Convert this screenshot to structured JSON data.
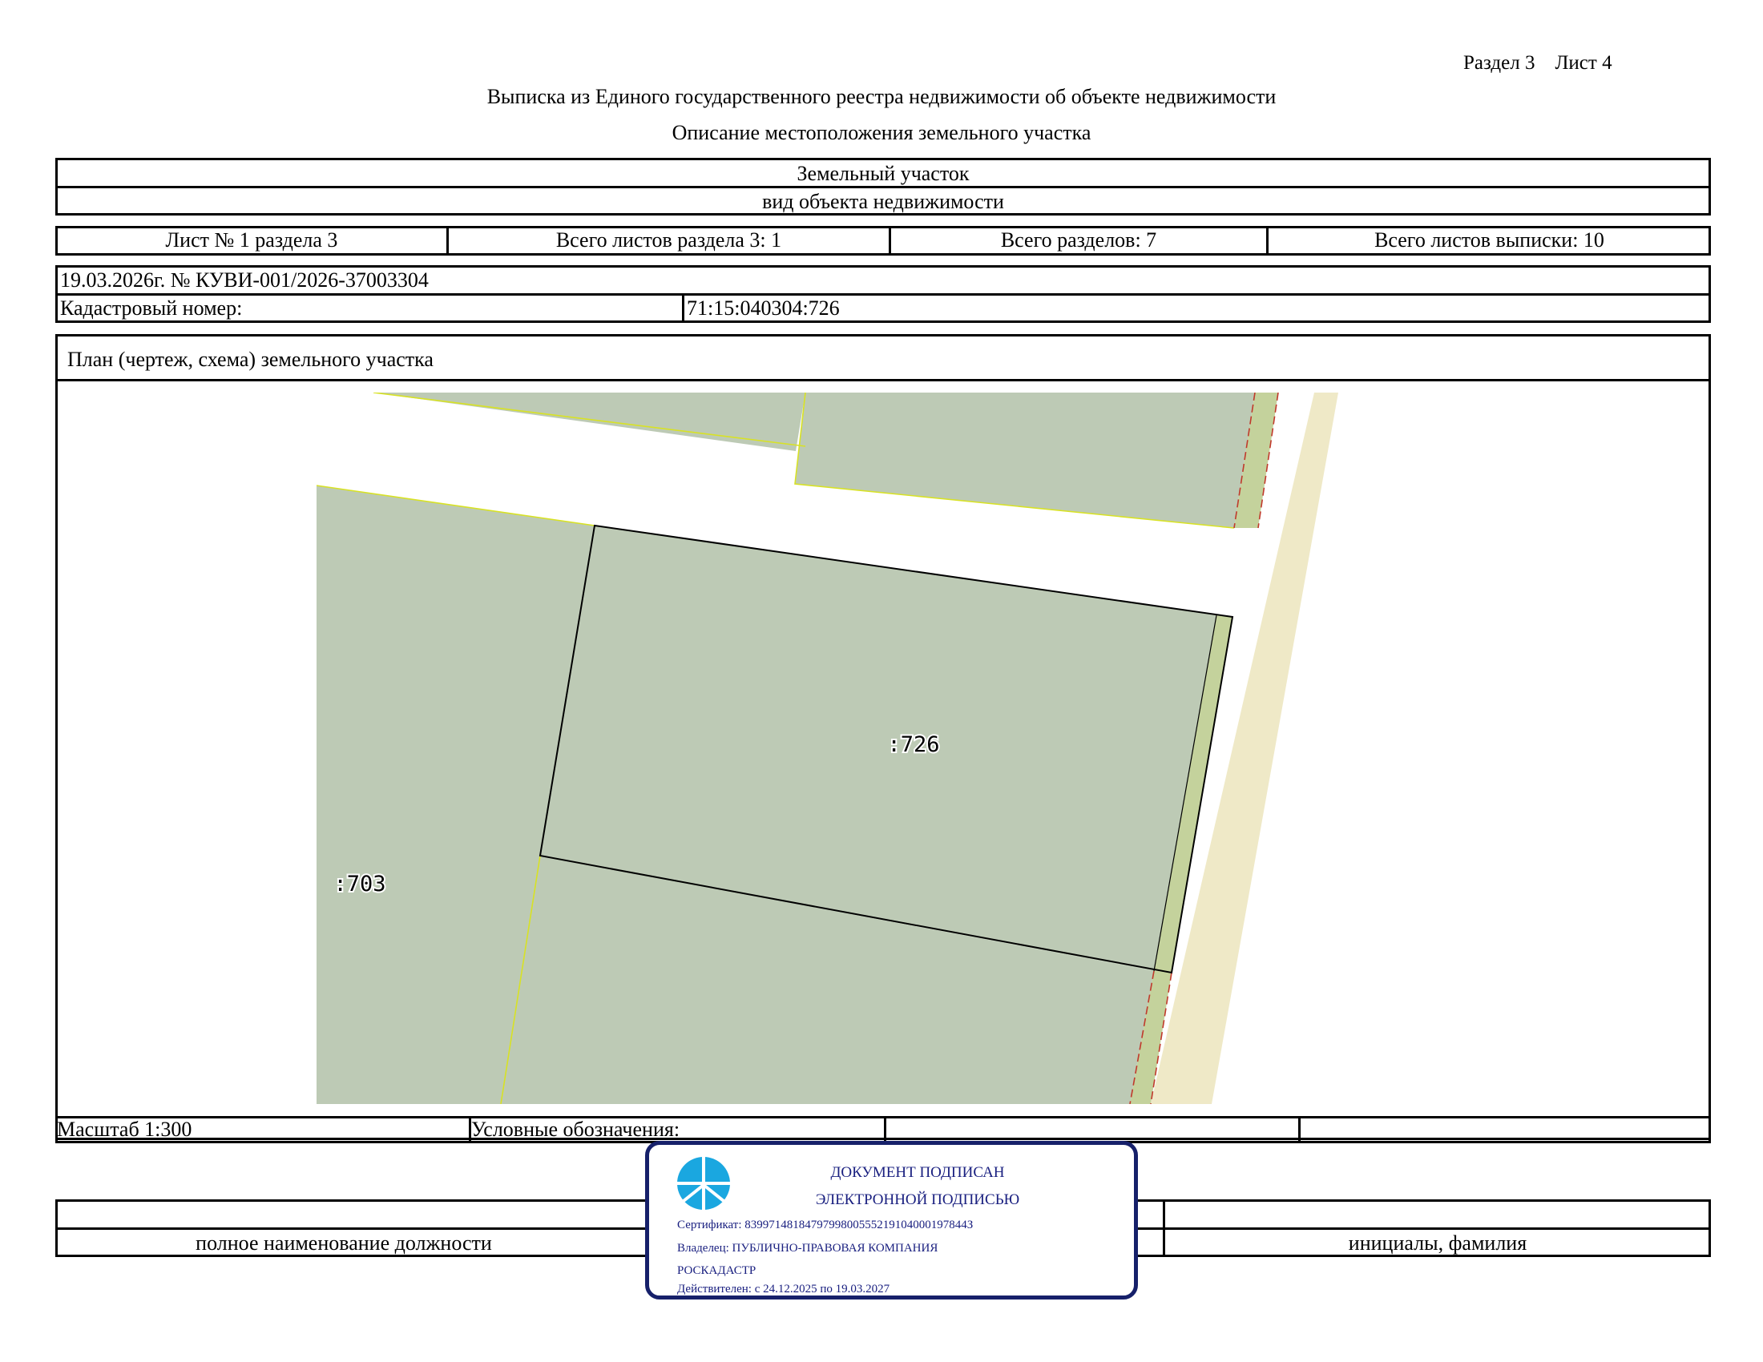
{
  "header": {
    "section": "Раздел 3",
    "sheet": "Лист 4",
    "title": "Выписка из Единого государственного реестра недвижимости об объекте недвижимости",
    "subtitle": "Описание местоположения земельного участка"
  },
  "object": {
    "type_value": "Земельный участок",
    "type_caption": "вид объекта недвижимости"
  },
  "sheet_info": {
    "sheet_no": "Лист № 1 раздела 3",
    "total_section_sheets": "Всего листов раздела 3: 1",
    "total_sections": "Всего разделов: 7",
    "total_extract_sheets": "Всего листов выписки: 10"
  },
  "record": {
    "date_number": "19.03.2026г. № КУВИ-001/2026-37003304",
    "cadastral_label": "Кадастровый номер:",
    "cadastral_value": "71:15:040304:726"
  },
  "plan": {
    "title": "План (чертеж, схема) земельного участка",
    "parcel_main_label": ":726",
    "parcel_neighbor_label": ":703",
    "colors": {
      "parcel_fill": "#bdcab5",
      "road_fill": "#efe9c7",
      "strip_fill": "#c4d29c",
      "neighbor_boundary": "#d8e224",
      "red_line": "#c0392b"
    }
  },
  "footer": {
    "scale": "Масштаб 1:300",
    "legend_label": "Условные обозначения:",
    "position_caption": "полное наименование должности",
    "name_caption": "инициалы, фамилия"
  },
  "stamp": {
    "logo_icon": "roskadastr-logo-icon",
    "line1": "ДОКУМЕНТ ПОДПИСАН",
    "line2": "ЭЛЕКТРОННОЙ ПОДПИСЬЮ",
    "certificate": "Сертификат: 8399714818479799800555219104000197844З",
    "owner": "Владелец: ПУБЛИЧНО-ПРАВОВАЯ КОМПАНИЯ",
    "owner_cont": "РОСКАДАСТР",
    "valid": "Действителен: с 24.12.2025 по 19.03.2027"
  }
}
